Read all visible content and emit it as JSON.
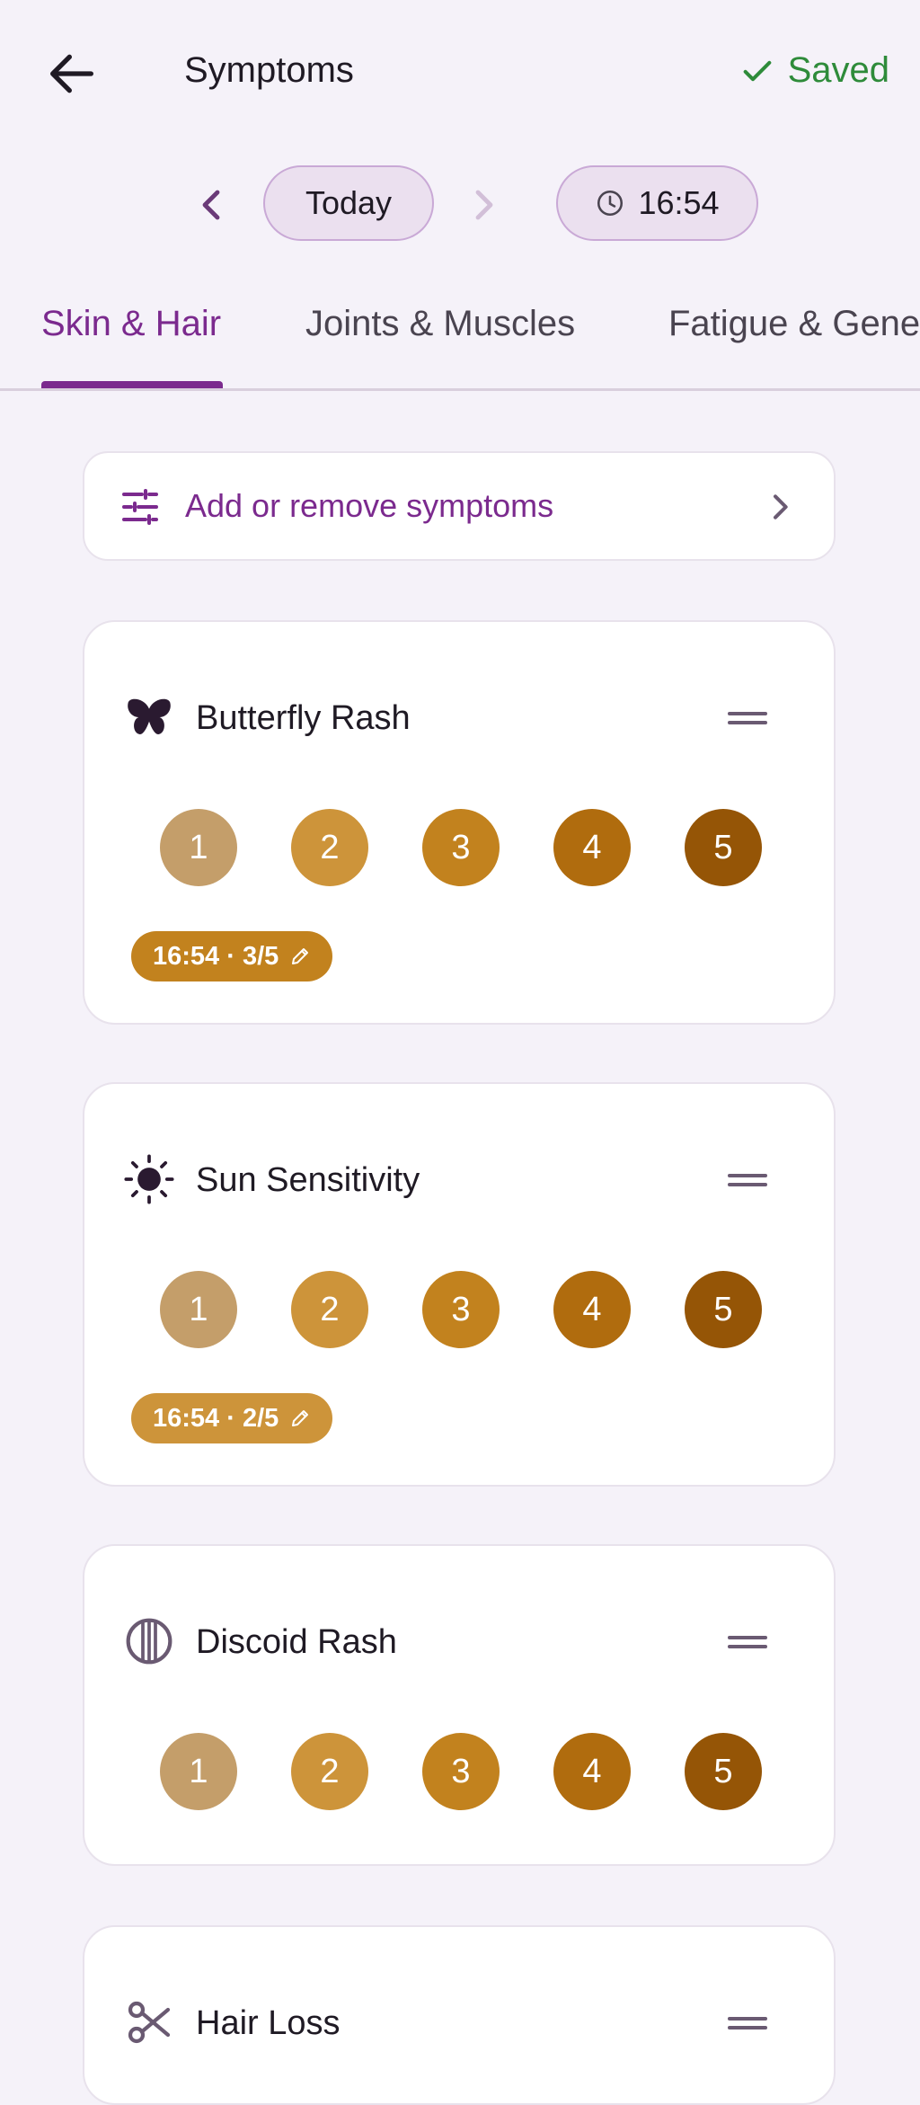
{
  "header": {
    "title": "Symptoms",
    "status": "Saved"
  },
  "datebar": {
    "date": "Today",
    "time": "16:54"
  },
  "tabs": [
    {
      "label": "Skin & Hair",
      "active": true
    },
    {
      "label": "Joints & Muscles",
      "active": false
    },
    {
      "label": "Fatigue & Gene",
      "active": false
    }
  ],
  "add_card": {
    "label": "Add or remove symptoms"
  },
  "severity_scale": [
    "1",
    "2",
    "3",
    "4",
    "5"
  ],
  "severity_colors": [
    "#c49e6a",
    "#cd943a",
    "#c2821e",
    "#b06c0e",
    "#955506"
  ],
  "colors": {
    "accent": "#7b2a8e",
    "saved": "#2e8b3a",
    "entry": "#c2821e"
  },
  "symptoms": [
    {
      "name": "Butterfly Rash",
      "icon": "butterfly-icon",
      "entry": "16:54 · 3/5"
    },
    {
      "name": "Sun Sensitivity",
      "icon": "sun-icon",
      "entry": "16:54 · 2/5"
    },
    {
      "name": "Discoid Rash",
      "icon": "discoid-icon",
      "entry": ""
    },
    {
      "name": "Hair Loss",
      "icon": "scissors-icon",
      "entry": ""
    }
  ]
}
